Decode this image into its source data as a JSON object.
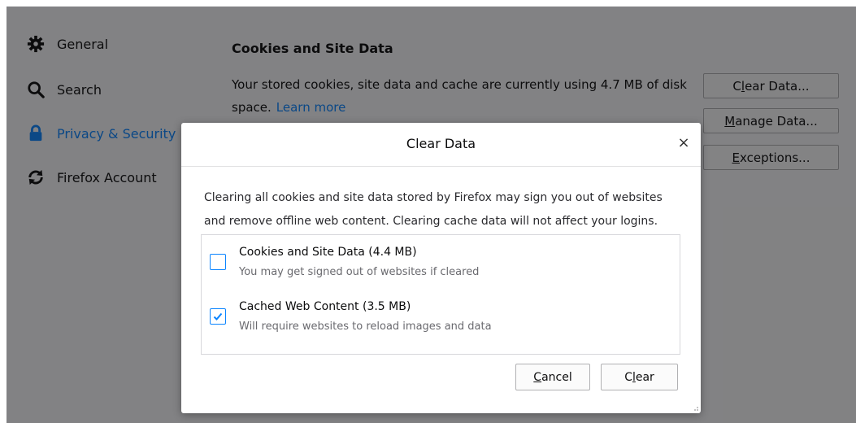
{
  "sidebar": {
    "items": [
      {
        "label": "General",
        "icon": "gear-icon"
      },
      {
        "label": "Search",
        "icon": "search-icon"
      },
      {
        "label": "Privacy & Security",
        "icon": "lock-icon",
        "active": true
      },
      {
        "label": "Firefox Account",
        "icon": "sync-icon"
      }
    ]
  },
  "main": {
    "section_title": "Cookies and Site Data",
    "description": "Your stored cookies, site data and cache are currently using 4.7 MB of disk space.",
    "learn_more": "Learn more",
    "buttons": {
      "clear_data": {
        "pre": "C",
        "key": "l",
        "post": "ear Data..."
      },
      "manage_data": {
        "pre": "",
        "key": "M",
        "post": "anage Data..."
      },
      "exceptions": {
        "pre": "",
        "key": "E",
        "post": "xceptions..."
      }
    }
  },
  "dialog": {
    "title": "Clear Data",
    "close_glyph": "×",
    "description": "Clearing all cookies and site data stored by Firefox may sign you out of websites and remove offline web content. Clearing cache data will not affect your logins.",
    "options": [
      {
        "label": "Cookies and Site Data (4.4 MB)",
        "sublabel": "You may get signed out of websites if cleared",
        "checked": false
      },
      {
        "label": "Cached Web Content (3.5 MB)",
        "sublabel": "Will require websites to reload images and data",
        "checked": true
      }
    ],
    "cancel": {
      "pre": "",
      "key": "C",
      "post": "ancel"
    },
    "clear": {
      "pre": "C",
      "key": "l",
      "post": "ear"
    }
  },
  "colors": {
    "accent": "#0a84ff",
    "overlay": "rgba(12,12,13,0.5)"
  }
}
